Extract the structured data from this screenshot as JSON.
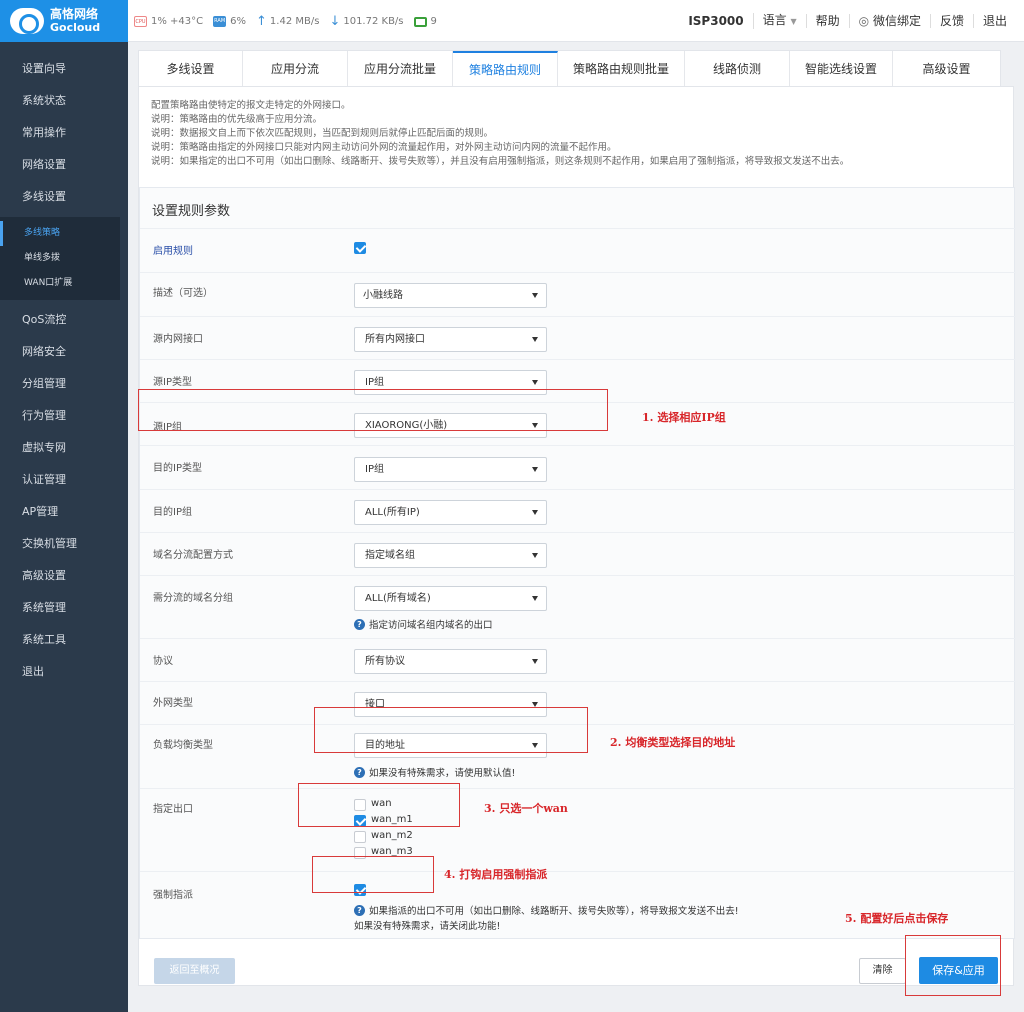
{
  "brand": {
    "name_cn": "高恪网络",
    "name_en": "Gocloud"
  },
  "stats": {
    "cpu_chip": "CPU",
    "cpu": "1% +43°C",
    "ram_chip": "RAM",
    "ram": "6%",
    "upload": "1.42 MB/s",
    "download": "101.72 KB/s",
    "devices": "9"
  },
  "toplinks": {
    "model": "ISP3000",
    "language": "语言",
    "help": "帮助",
    "wechat": "微信绑定",
    "feedback": "反馈",
    "logout": "退出"
  },
  "sidebar": {
    "items_top": [
      "设置向导",
      "系统状态",
      "常用操作",
      "网络设置",
      "多线设置"
    ],
    "sub": [
      "多线策略",
      "单线多拨",
      "WAN口扩展"
    ],
    "items_bottom": [
      "QoS流控",
      "网络安全",
      "分组管理",
      "行为管理",
      "虚拟专网",
      "认证管理",
      "AP管理",
      "交换机管理",
      "高级设置",
      "系统管理",
      "系统工具",
      "退出"
    ]
  },
  "tabs": [
    "多线设置",
    "应用分流",
    "应用分流批量",
    "策略路由规则",
    "策略路由规则批量",
    "线路侦测",
    "智能选线设置",
    "高级设置"
  ],
  "notes": [
    "配置策略路由使特定的报文走特定的外网接口。",
    "说明：策略路由的优先级高于应用分流。",
    "说明：数据报文自上而下依次匹配规则，当匹配到规则后就停止匹配后面的规则。",
    "说明：策略路由指定的外网接口只能对内网主动访问外网的流量起作用，对外网主动访问内网的流量不起作用。",
    "说明：如果指定的出口不可用（如出口删除、线路断开、拨号失败等），并且没有启用强制指派，则这条规则不起作用，如果启用了强制指派，将导致报文发送不出去。"
  ],
  "section_title": "设置规则参数",
  "form": {
    "enable_label": "启用规则",
    "enable_checked": true,
    "desc_label": "描述（可选）",
    "desc_value": "小融线路",
    "src_iface_label": "源内网接口",
    "src_iface_value": "所有内网接口",
    "src_ip_type_label": "源IP类型",
    "src_ip_type_value": "IP组",
    "src_ip_group_label": "源IP组",
    "src_ip_group_value": "XIAORONG(小融)",
    "dst_ip_type_label": "目的IP类型",
    "dst_ip_type_value": "IP组",
    "dst_ip_group_label": "目的IP组",
    "dst_ip_group_value": "ALL(所有IP)",
    "domain_mode_label": "域名分流配置方式",
    "domain_mode_value": "指定域名组",
    "domain_group_label": "需分流的域名分组",
    "domain_group_value": "ALL(所有域名)",
    "domain_group_help": "指定访问域名组内域名的出口",
    "protocol_label": "协议",
    "protocol_value": "所有协议",
    "wan_type_label": "外网类型",
    "wan_type_value": "接口",
    "lb_label": "负载均衡类型",
    "lb_value": "目的地址",
    "lb_help": "如果没有特殊需求，请使用默认值!",
    "outlet_label": "指定出口",
    "outlets": [
      {
        "name": "wan",
        "checked": false
      },
      {
        "name": "wan_m1",
        "checked": true
      },
      {
        "name": "wan_m2",
        "checked": false
      },
      {
        "name": "wan_m3",
        "checked": false
      }
    ],
    "force_label": "强制指派",
    "force_checked": true,
    "force_help1": "如果指派的出口不可用（如出口删除、线路断开、拨号失败等），将导致报文发送不出去!",
    "force_help2": "如果没有特殊需求，请关闭此功能!"
  },
  "annotations": [
    "1. 选择相应IP组",
    "2. 均衡类型选择目的地址",
    "3. 只选一个wan",
    "4. 打钩启用强制指派",
    "5. 配置好后点击保存"
  ],
  "buttons": {
    "back": "返回至概况",
    "clear": "清除",
    "save": "保存&应用"
  }
}
